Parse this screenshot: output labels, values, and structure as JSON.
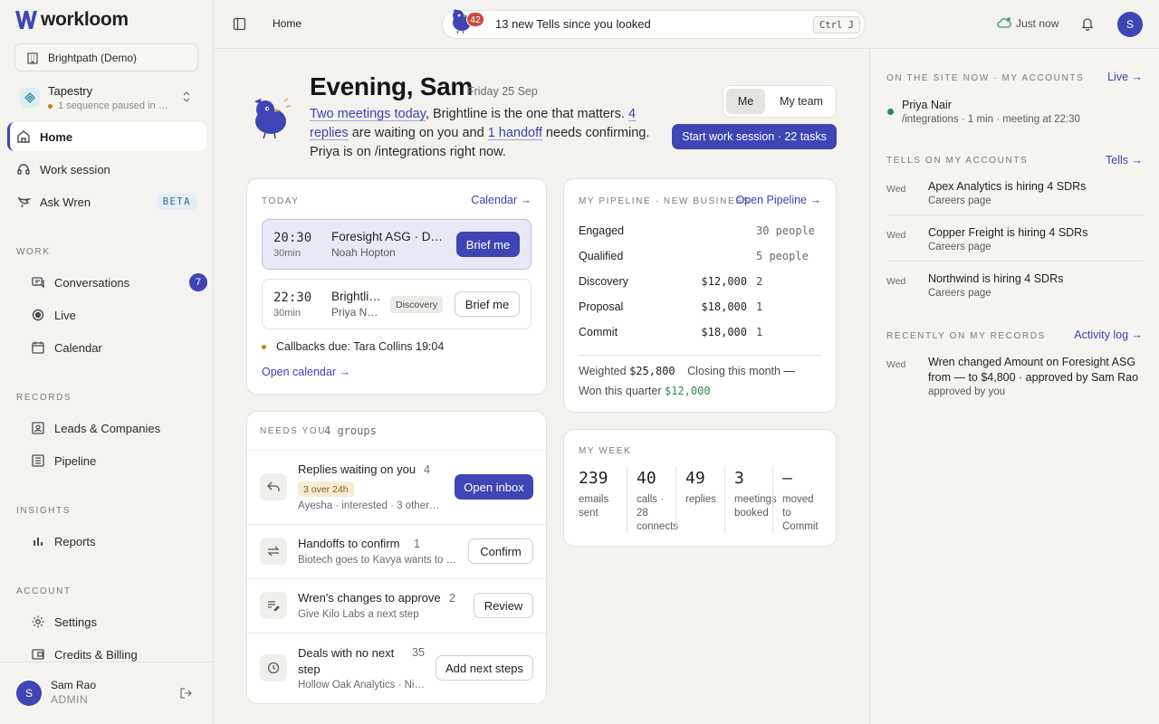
{
  "brand": {
    "name": "workloom",
    "color": "#3f45b5"
  },
  "sidebar": {
    "workspace": "Brightpath (Demo)",
    "account": {
      "name": "Tapestry",
      "status": "1 sequence paused in …"
    },
    "primary": [
      {
        "label": "Home",
        "icon": "home-icon"
      },
      {
        "label": "Work session",
        "icon": "headset-icon"
      },
      {
        "label": "Ask Wren",
        "icon": "bird-icon",
        "badge": "BETA"
      }
    ],
    "sections": {
      "work": "WORK",
      "records": "RECORDS",
      "insights": "INSIGHTS",
      "account": "ACCOUNT"
    },
    "work_items": [
      {
        "label": "Conversations",
        "badge": "7"
      },
      {
        "label": "Live"
      },
      {
        "label": "Calendar"
      }
    ],
    "records_items": [
      {
        "label": "Leads & Companies"
      },
      {
        "label": "Pipeline"
      }
    ],
    "insights_items": [
      {
        "label": "Reports"
      }
    ],
    "account_items": [
      {
        "label": "Settings"
      },
      {
        "label": "Credits & Billing"
      }
    ],
    "user": {
      "initial": "S",
      "name": "Sam Rao",
      "role": "ADMIN"
    }
  },
  "topbar": {
    "breadcrumb": "Home",
    "tells": {
      "count": "42",
      "text": "13 new Tells since you looked",
      "shortcut": "Ctrl J"
    },
    "sync": "Just now",
    "avatar": "S"
  },
  "greeting": {
    "title": "Evening, Sam",
    "date": "Friday 25 Sep",
    "summary": {
      "link1": "Two meetings today",
      "text1": ", Brightline is the one that matters. ",
      "link2": "4 replies",
      "text2": " are waiting on you and ",
      "link3": "1 handoff",
      "text3": " needs confirming. Priya is on /integrations right now."
    },
    "toggle": {
      "me": "Me",
      "team": "My team"
    },
    "start_button": "Start work session · 22 tasks"
  },
  "today": {
    "label": "TODAY",
    "calendar_link": "Calendar →",
    "meetings": [
      {
        "time": "20:30",
        "duration": "30min",
        "title": "Foresight ASG · Di…",
        "person": "Noah Hopton",
        "button": "Brief me"
      },
      {
        "time": "22:30",
        "duration": "30min",
        "title": "Brightli…",
        "person": "Priya Na…",
        "tag": "Discovery",
        "button": "Brief me"
      }
    ],
    "callbacks": "Callbacks due: Tara Collins 19:04",
    "open_calendar": "Open calendar →"
  },
  "needs": {
    "label": "NEEDS YOU",
    "count": "4 groups",
    "rows": [
      {
        "title": "Replies waiting on you",
        "count": "4",
        "badge": "3 over 24h",
        "sub": "Ayesha · interested · 3 others …",
        "button": "Open inbox"
      },
      {
        "title": "Handoffs to confirm",
        "count": "1",
        "sub": "Biotech goes to Kavya wants to r…",
        "button": "Confirm"
      },
      {
        "title": "Wren's changes to approve",
        "count": "2",
        "sub": "Give Kilo Labs a next step",
        "button": "Review"
      },
      {
        "title": "Deals with no next step",
        "count": "35",
        "sub": "Hollow Oak Analytics · Ni…",
        "button": "Add next steps"
      }
    ]
  },
  "pipeline": {
    "label": "MY PIPELINE · NEW BUSINESS",
    "link": "Open Pipeline →",
    "stages": [
      {
        "name": "Engaged",
        "amount": "",
        "count": "30 people"
      },
      {
        "name": "Qualified",
        "amount": "",
        "count": "5 people"
      },
      {
        "name": "Discovery",
        "amount": "$12,000",
        "count": "2"
      },
      {
        "name": "Proposal",
        "amount": "$18,000",
        "count": "1"
      },
      {
        "name": "Commit",
        "amount": "$18,000",
        "count": "1"
      }
    ],
    "weighted_label": "Weighted",
    "weighted_value": "$25,800",
    "closing_label": "Closing this month",
    "closing_value": "—",
    "won_label": "Won this quarter",
    "won_value": "$12,000"
  },
  "week": {
    "label": "MY WEEK",
    "stats": [
      {
        "value": "239",
        "l1": "emails",
        "l2": "sent",
        "l3": ""
      },
      {
        "value": "40",
        "l1": "calls ·",
        "l2": "28",
        "l3": "connects"
      },
      {
        "value": "49",
        "l1": "replies",
        "l2": "",
        "l3": ""
      },
      {
        "value": "3",
        "l1": "meetings",
        "l2": "booked",
        "l3": ""
      },
      {
        "value": "—",
        "l1": "moved",
        "l2": "to",
        "l3": "Commit"
      }
    ]
  },
  "right": {
    "onsite_label": "ON THE SITE NOW · MY ACCOUNTS",
    "onsite_link": "Live →",
    "visitor": {
      "name": "Priya Nair",
      "detail": "/integrations · 1 min · meeting at 22:30"
    },
    "tells_label": "TELLS ON MY ACCOUNTS",
    "tells_link": "Tells →",
    "tells": [
      {
        "day": "Wed",
        "title": "Apex Analytics is hiring 4 SDRs",
        "source": "Careers page"
      },
      {
        "day": "Wed",
        "title": "Copper Freight is hiring 4 SDRs",
        "source": "Careers page"
      },
      {
        "day": "Wed",
        "title": "Northwind is hiring 4 SDRs",
        "source": "Careers page"
      }
    ],
    "recent_label": "RECENTLY ON MY RECORDS",
    "recent_link": "Activity log →",
    "recent": {
      "day": "Wed",
      "line1": "Wren changed Amount on Foresight ASG",
      "line2": "from — to $4,800 · approved by Sam Rao",
      "line3": "approved by you"
    }
  }
}
